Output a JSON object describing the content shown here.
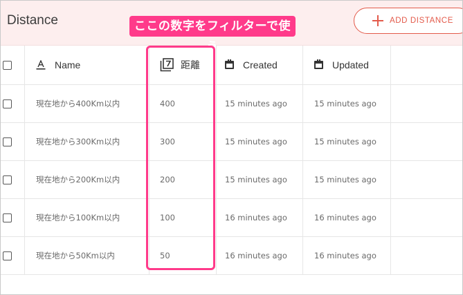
{
  "header": {
    "title": "Distance",
    "annotation": "ここの数字をフィルターで使う",
    "add_button_label": "ADD DISTANCE"
  },
  "columns": {
    "name": "Name",
    "distance": "距離",
    "created": "Created",
    "updated": "Updated"
  },
  "rows": [
    {
      "name": "現在地から400Km以内",
      "distance": "400",
      "created": "15 minutes ago",
      "updated": "15 minutes ago"
    },
    {
      "name": "現在地から300Km以内",
      "distance": "300",
      "created": "15 minutes ago",
      "updated": "15 minutes ago"
    },
    {
      "name": "現在地から200Km以内",
      "distance": "200",
      "created": "15 minutes ago",
      "updated": "15 minutes ago"
    },
    {
      "name": "現在地から100Km以内",
      "distance": "100",
      "created": "16 minutes ago",
      "updated": "16 minutes ago"
    },
    {
      "name": "現在地から50Km以内",
      "distance": "50",
      "created": "16 minutes ago",
      "updated": "16 minutes ago"
    }
  ],
  "colors": {
    "header_bg": "#fdeeee",
    "accent": "#e35a4a",
    "annotation": "#ff3a8a"
  },
  "icons": {
    "name_column": "text-format-icon",
    "distance_column": "number-seven-icon",
    "created_column": "calendar-icon",
    "updated_column": "calendar-icon",
    "add_button": "plus-icon"
  }
}
